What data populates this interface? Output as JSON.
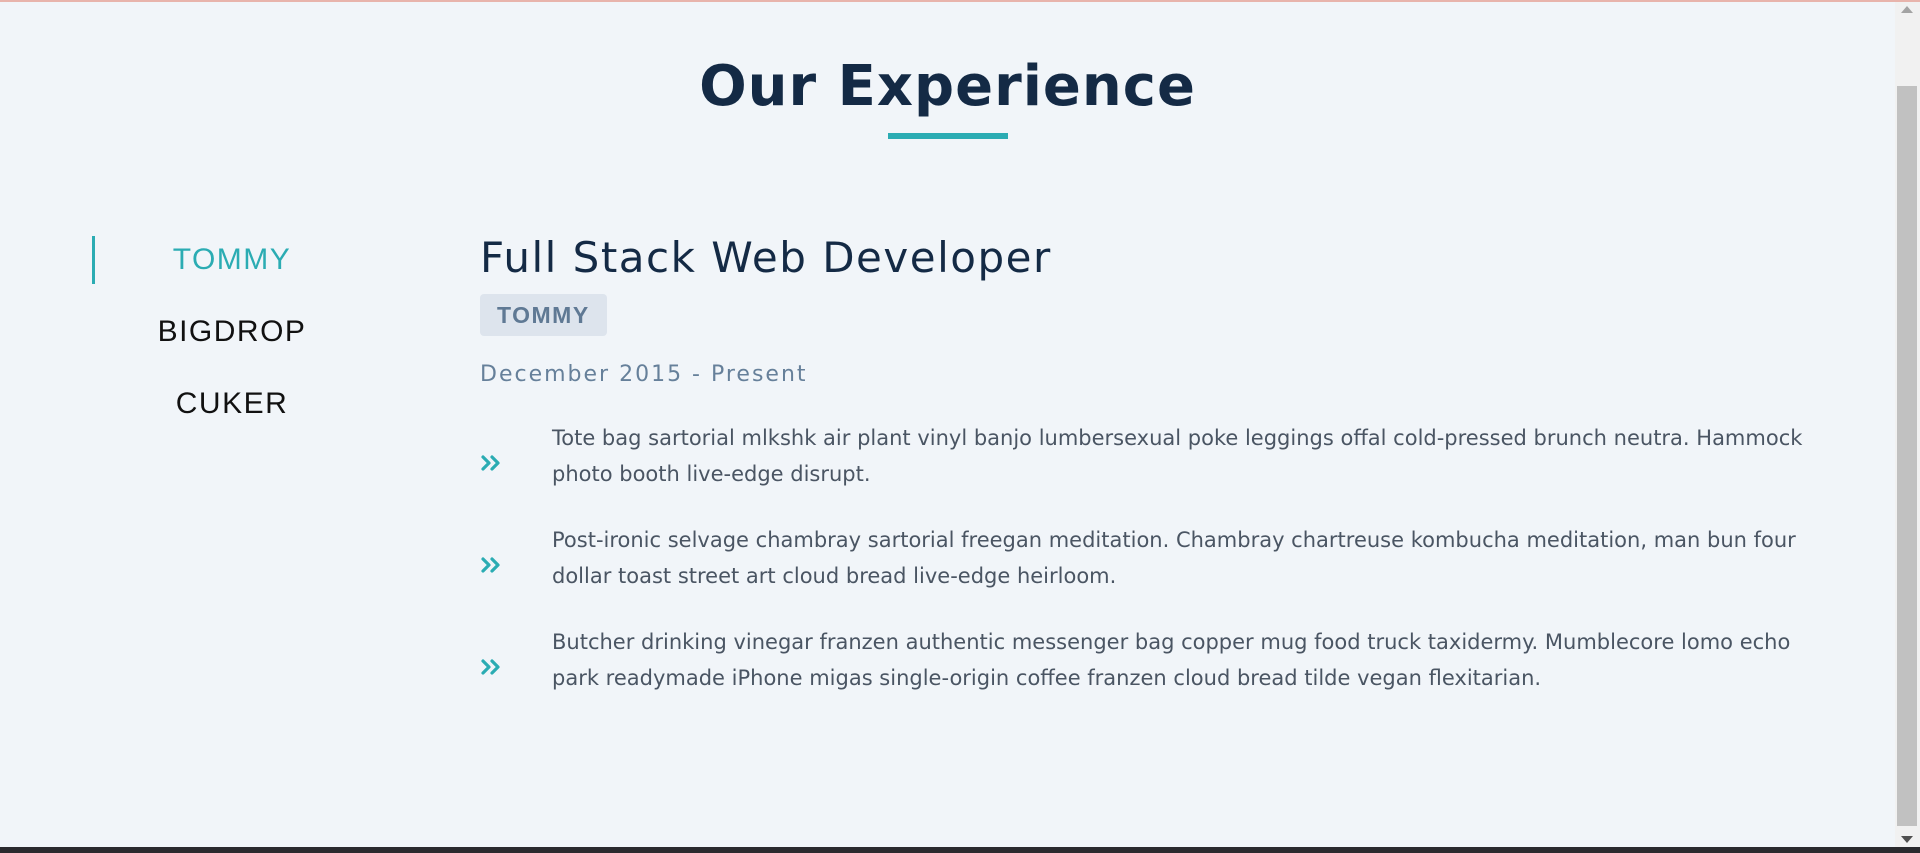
{
  "section": {
    "title": "Our Experience"
  },
  "tabs": [
    {
      "label": "TOMMY",
      "active": true
    },
    {
      "label": "BIGDROP",
      "active": false
    },
    {
      "label": "CUKER",
      "active": false
    }
  ],
  "job": {
    "title": "Full Stack Web Developer",
    "company": "TOMMY",
    "dates": "December 2015 - Present",
    "duties": [
      "Tote bag sartorial mlkshk air plant vinyl banjo lumbersexual poke leggings offal cold-pressed brunch neutra. Hammock photo booth live-edge disrupt.",
      "Post-ironic selvage chambray sartorial freegan meditation. Chambray chartreuse kombucha meditation, man bun four dollar toast street art cloud bread live-edge heirloom.",
      "Butcher drinking vinegar franzen authentic messenger bag copper mug food truck taxidermy. Mumblecore lomo echo park readymade iPhone migas single-origin coffee franzen cloud bread tilde vegan flexitarian."
    ],
    "duty_icon": "double-chevron-right-icon"
  },
  "colors": {
    "accent": "#2bacb3",
    "heading": "#142a45",
    "background": "#f1f5f9",
    "badge_bg": "#dde4ed",
    "badge_text": "#5f7994",
    "body_text": "#4a5563"
  }
}
